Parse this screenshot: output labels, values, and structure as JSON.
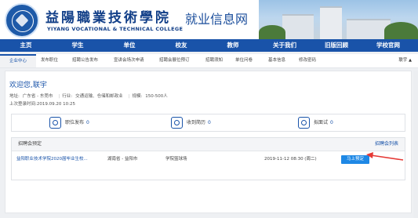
{
  "header": {
    "school_name_cn": "益陽職業技術學院",
    "school_name_en": "YIYANG VOCATIONAL & TECHNICAL COLLEGE",
    "site_title": "就业信息网",
    "logo_icon": "school-seal-icon",
    "photo": "campus-photo"
  },
  "nav": {
    "items": [
      "主页",
      "学生",
      "单位",
      "校友",
      "教师",
      "关于我们",
      "旧版回顾",
      "学校官网"
    ],
    "background": "#1953a9"
  },
  "tabs": {
    "items": [
      "企业中心",
      "发布职位",
      "招聘公告发布",
      "宣讲会场次申请",
      "招聘会展位预订",
      "招聘须知",
      "单位问卷",
      "基本信息",
      "修改密码"
    ],
    "active_index": 0,
    "user_menu": "联宇"
  },
  "welcome": {
    "greeting": "欢迎您,联宇",
    "address_label": "地址:",
    "address_value": "广东省 - 东莞市",
    "industry_label": "行业:",
    "industry_value": "交通运输、仓储和邮政业",
    "scale_label": "规模:",
    "scale_value": "150-500人",
    "last_login": "上次登录时间:2019.09.20 10:25"
  },
  "stats": [
    {
      "label": "职位发布",
      "count": "0",
      "icon": "document-icon"
    },
    {
      "label": "收到简历",
      "count": "0",
      "icon": "resume-icon"
    },
    {
      "label": "拟面试",
      "count": "0",
      "icon": "interview-icon"
    }
  ],
  "job_fair": {
    "title": "招聘会预定",
    "more_link": "招聘会列表",
    "rows": [
      {
        "name": "益阳职业技术学院2020届毕业生校...",
        "region": "湖南省 - 益阳市",
        "venue": "学院篮球场",
        "time": "2019-11-12 08:30 (周二)",
        "action": "马上预定"
      }
    ]
  },
  "colors": {
    "primary": "#1953a9",
    "button": "#1e88e5",
    "annotation_arrow": "#e53935"
  }
}
